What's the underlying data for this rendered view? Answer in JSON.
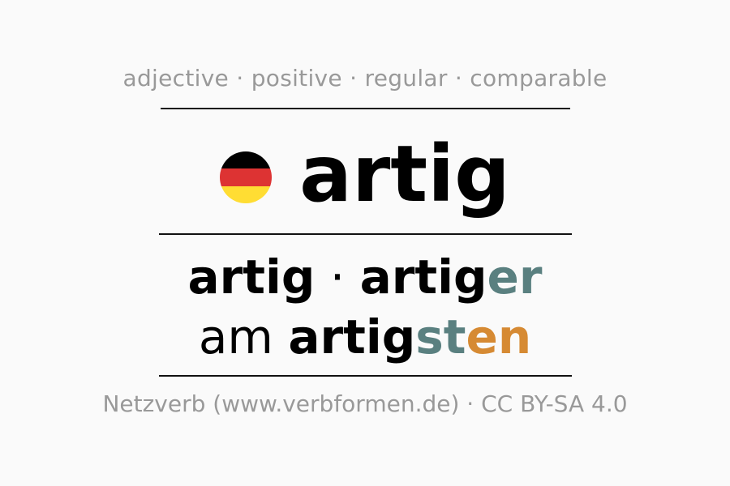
{
  "tags": "adjective · positive · regular · comparable",
  "headword": "artig",
  "flag": {
    "icon": "germany-flag-icon",
    "colors": [
      "#000000",
      "#dd3333",
      "#ffdd33"
    ]
  },
  "forms": {
    "positive": "artig",
    "separator": " · ",
    "comparative_stem": "artig",
    "comparative_ending": "er",
    "superlative_prefix": "am ",
    "superlative_stem": "artig",
    "superlative_ending_1": "st",
    "superlative_ending_2": "en"
  },
  "colors": {
    "ending_teal": "#5a8080",
    "ending_orange": "#d68a33"
  },
  "credit": "Netzverb (www.verbformen.de) · CC BY-SA 4.0"
}
